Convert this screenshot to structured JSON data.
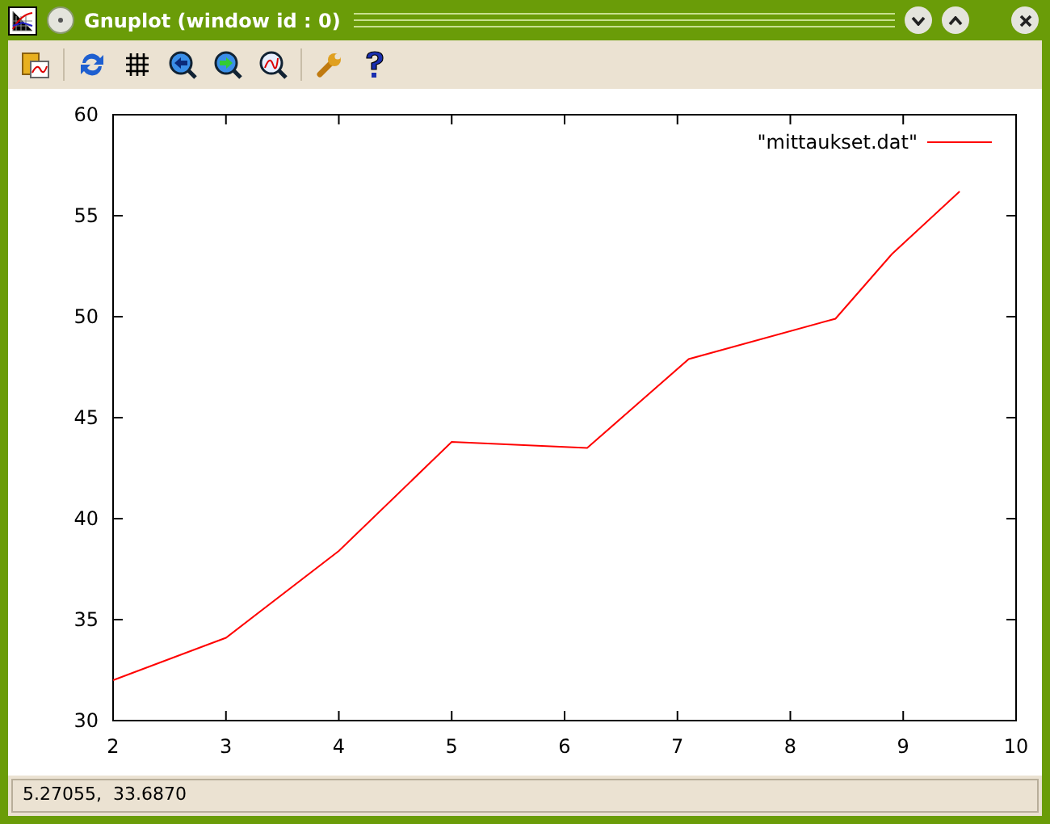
{
  "window": {
    "title": "Gnuplot (window id : 0)"
  },
  "chart": {
    "chart_data": {
      "type": "line",
      "x": [
        2,
        3,
        4,
        5,
        6.2,
        7.1,
        8.4,
        8.9,
        9.5
      ],
      "series": [
        {
          "name": "\"mittaukset.dat\"",
          "color": "#ff0000",
          "values": [
            32,
            34.1,
            38.4,
            43.8,
            43.5,
            47.9,
            49.9,
            53.1,
            56.2
          ]
        }
      ],
      "xlim": [
        2,
        10
      ],
      "ylim": [
        30,
        60
      ],
      "xticks": [
        2,
        3,
        4,
        5,
        6,
        7,
        8,
        9,
        10
      ],
      "yticks": [
        30,
        35,
        40,
        45,
        50,
        55,
        60
      ]
    }
  },
  "status_bar": {
    "text": "5.27055,  33.6870"
  }
}
